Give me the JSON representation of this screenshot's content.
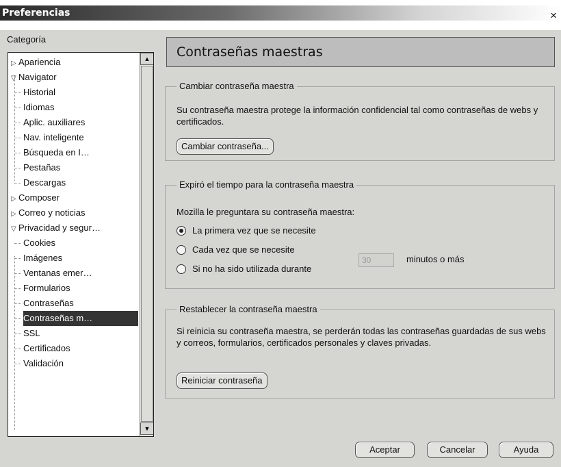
{
  "window": {
    "title": "Preferencias",
    "close_glyph": "×"
  },
  "category_label": "Categoría",
  "tree": [
    {
      "label": "Apariencia",
      "level": 0,
      "expander": "collapsed"
    },
    {
      "label": "Navigator",
      "level": 0,
      "expander": "expanded"
    },
    {
      "label": "Historial",
      "level": 1
    },
    {
      "label": "Idiomas",
      "level": 1
    },
    {
      "label": "Aplic. auxiliares",
      "level": 1
    },
    {
      "label": "Nav. inteligente",
      "level": 1
    },
    {
      "label": "Búsqueda en I…",
      "level": 1
    },
    {
      "label": "Pestañas",
      "level": 1
    },
    {
      "label": "Descargas",
      "level": 1
    },
    {
      "label": "Composer",
      "level": 0,
      "expander": "collapsed"
    },
    {
      "label": "Correo y noticias",
      "level": 0,
      "expander": "collapsed"
    },
    {
      "label": "Privacidad y segur…",
      "level": 0,
      "expander": "expanded"
    },
    {
      "label": "Cookies",
      "level": 1
    },
    {
      "label": "Imágenes",
      "level": 1
    },
    {
      "label": "Ventanas emer…",
      "level": 1
    },
    {
      "label": "Formularios",
      "level": 1
    },
    {
      "label": "Contraseñas",
      "level": 1
    },
    {
      "label": "Contraseñas m…",
      "level": 1,
      "selected": true
    },
    {
      "label": "SSL",
      "level": 1
    },
    {
      "label": "Certificados",
      "level": 1
    },
    {
      "label": "Validación",
      "level": 1
    }
  ],
  "panel": {
    "header": "Contraseñas maestras",
    "change": {
      "title": "Cambiar contraseña maestra",
      "text": "Su contraseña maestra protege la información confidencial tal como contraseñas de webs y certificados.",
      "button": "Cambiar contraseña..."
    },
    "timeout": {
      "title": "Expiró el tiempo para la contraseña maestra",
      "prompt": "Mozilla le preguntara su contraseña maestra:",
      "options": [
        {
          "label": "La primera vez que se necesite",
          "checked": true
        },
        {
          "label": "Cada vez que se necesite",
          "checked": false
        },
        {
          "label": "Si no ha sido utilizada durante",
          "checked": false
        }
      ],
      "minutes_value": "30",
      "minutes_label": "minutos o más"
    },
    "reset": {
      "title": "Restablecer la contraseña maestra",
      "text": "Si reinicia su contraseña maestra, se perderán todas las contraseñas guardadas de sus webs y correos, formularios, certificados personales y claves privadas.",
      "button": "Reiniciar contraseña"
    }
  },
  "footer": {
    "ok": "Aceptar",
    "cancel": "Cancelar",
    "help": "Ayuda"
  },
  "colors": {
    "selection": "#343434",
    "dialog_bg": "#d5d5d1",
    "header_bg": "#bdbdbd"
  }
}
